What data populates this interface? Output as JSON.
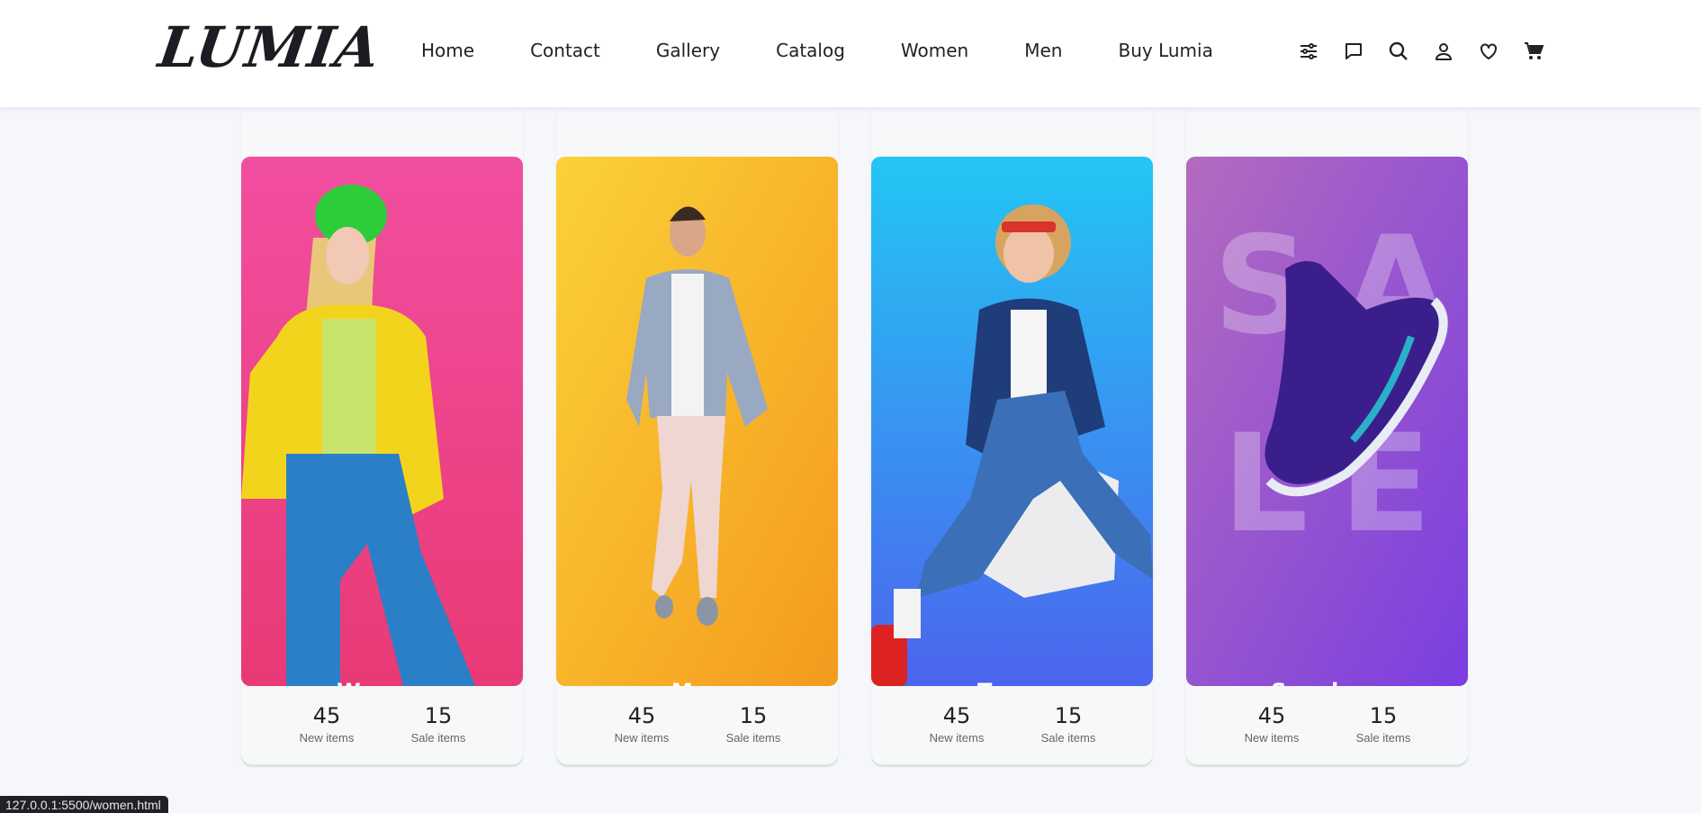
{
  "brand": {
    "logo": "LUMIA"
  },
  "nav": [
    "Home",
    "Contact",
    "Gallery",
    "Catalog",
    "Women",
    "Men",
    "Buy Lumia"
  ],
  "header_icons": [
    "filter-sliders-icon",
    "chat-icon",
    "search-icon",
    "user-icon",
    "heart-icon",
    "cart-icon"
  ],
  "categories": [
    {
      "title": "Women",
      "new_count": "45",
      "new_label": "New items",
      "sale_count": "15",
      "sale_label": "Sale items",
      "gradient": [
        "#f24ea0",
        "#e83a75"
      ]
    },
    {
      "title": "Men",
      "new_count": "45",
      "new_label": "New items",
      "sale_count": "15",
      "sale_label": "Sale items",
      "gradient": [
        "#fbd138",
        "#f49a1e"
      ]
    },
    {
      "title": "Teens",
      "new_count": "45",
      "new_label": "New items",
      "sale_count": "15",
      "sale_label": "Sale items",
      "gradient": [
        "#23c6f4",
        "#4c64ee"
      ]
    },
    {
      "title": "Sneakers",
      "new_count": "45",
      "new_label": "New items",
      "sale_count": "15",
      "sale_label": "Sale items",
      "gradient": [
        "#b36bbf",
        "#7a3ee0"
      ],
      "overlay_text": [
        "S",
        "A",
        "L",
        "E"
      ]
    }
  ],
  "status_url": "127.0.0.1:5500/women.html"
}
